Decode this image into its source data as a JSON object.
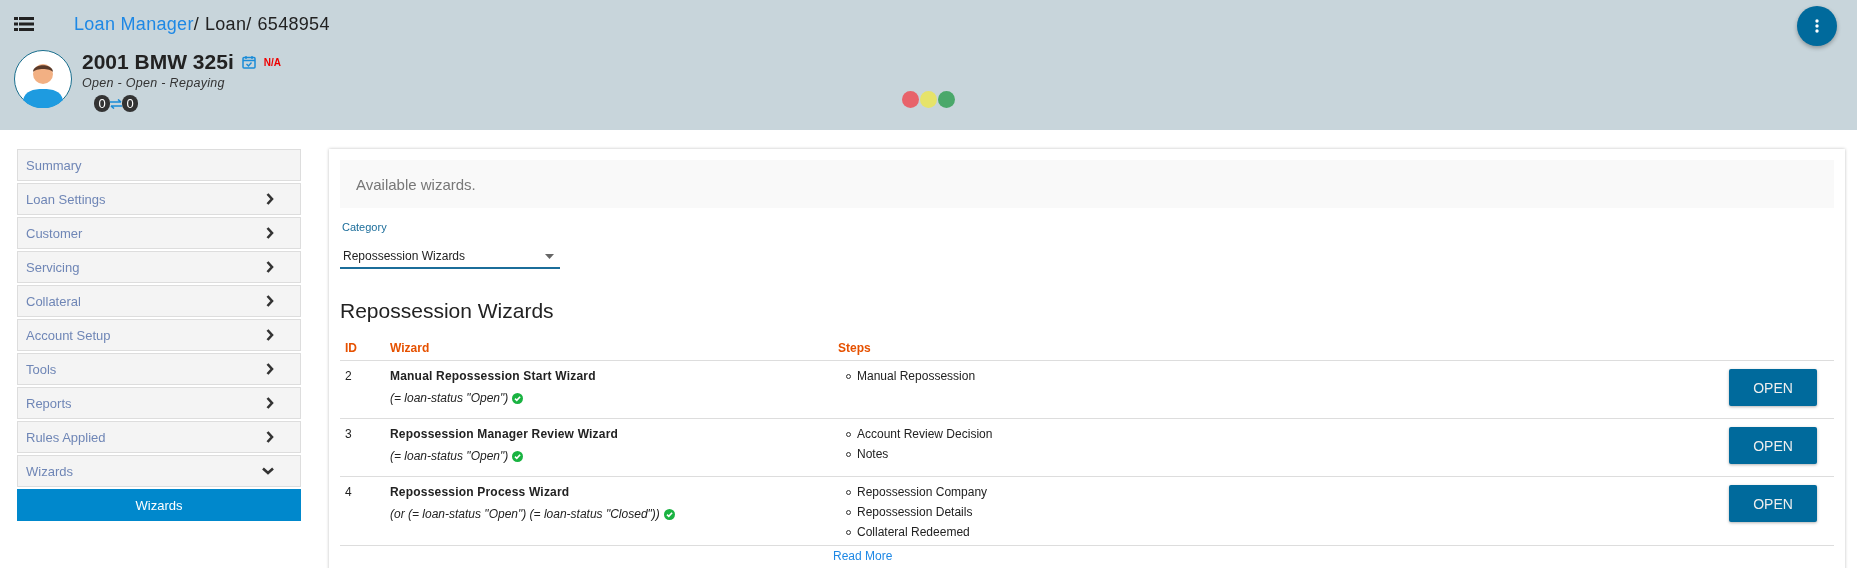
{
  "header": {
    "breadcrumb_separator": "/",
    "breadcrumb": [
      {
        "label": "Loan Manager",
        "kind": "link"
      },
      {
        "label": "Loan",
        "kind": "text"
      },
      {
        "label": "6548954",
        "kind": "text"
      }
    ],
    "title": "2001 BMW 325i",
    "date_badge": "N/A",
    "status": "Open - Open - Repaying",
    "counts": [
      "0",
      "0"
    ],
    "lights": [
      {
        "color": "#e8636b"
      },
      {
        "color": "#e6e36a"
      },
      {
        "color": "#4aa86a"
      }
    ]
  },
  "sidebar": {
    "items": [
      {
        "label": "Summary",
        "kind": "link"
      },
      {
        "label": "Loan Settings",
        "kind": "group",
        "expanded": false
      },
      {
        "label": "Customer",
        "kind": "group",
        "expanded": false
      },
      {
        "label": "Servicing",
        "kind": "group",
        "expanded": false
      },
      {
        "label": "Collateral",
        "kind": "group",
        "expanded": false
      },
      {
        "label": "Account Setup",
        "kind": "group",
        "expanded": false
      },
      {
        "label": "Tools",
        "kind": "group",
        "expanded": false
      },
      {
        "label": "Reports",
        "kind": "group",
        "expanded": false
      },
      {
        "label": "Rules Applied",
        "kind": "group",
        "expanded": false
      },
      {
        "label": "Wizards",
        "kind": "group",
        "expanded": true,
        "children": [
          {
            "label": "Wizards",
            "selected": true
          }
        ]
      }
    ]
  },
  "content": {
    "banner": "Available wizards.",
    "category": {
      "label": "Category",
      "value": "Repossession Wizards"
    },
    "heading": "Repossession Wizards",
    "table": {
      "columns": [
        "ID",
        "Wizard",
        "Steps"
      ],
      "rows": [
        {
          "id": "2",
          "name": "Manual Repossession Start Wizard",
          "condition": "(= loan-status \"Open\")",
          "met": true,
          "steps": [
            "Manual Repossession"
          ],
          "button": "OPEN"
        },
        {
          "id": "3",
          "name": "Repossession Manager Review Wizard",
          "condition": "(= loan-status \"Open\")",
          "met": true,
          "steps": [
            "Account Review Decision",
            "Notes"
          ],
          "button": "OPEN"
        },
        {
          "id": "4",
          "name": "Repossession Process Wizard",
          "condition": "(or (= loan-status \"Open\") (= loan-status \"Closed\"))",
          "met": true,
          "steps": [
            "Repossession Company",
            "Repossession Details",
            "Collateral Redeemed"
          ],
          "button": "OPEN",
          "more": "Read More"
        }
      ]
    }
  }
}
